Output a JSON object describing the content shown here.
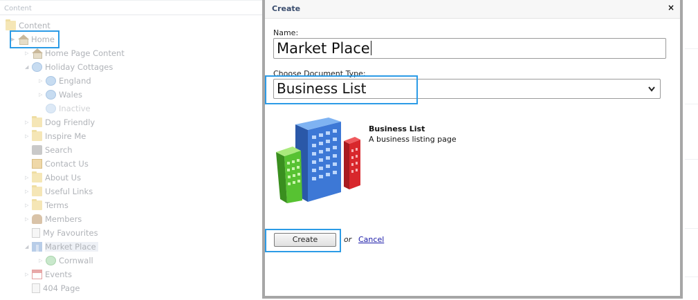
{
  "tree": {
    "header": "Content",
    "items": [
      {
        "label": "Content",
        "icon": "folder-icon"
      },
      {
        "label": "Home",
        "icon": "house-icon"
      },
      {
        "label": "Home Page Content",
        "icon": "house-icon"
      },
      {
        "label": "Holiday Cottages",
        "icon": "globe-icon"
      },
      {
        "label": "England",
        "icon": "globe-icon"
      },
      {
        "label": "Wales",
        "icon": "globe-icon"
      },
      {
        "label": "Inactive",
        "icon": "globe-icon"
      },
      {
        "label": "Dog Friendly",
        "icon": "folder-icon"
      },
      {
        "label": "Inspire Me",
        "icon": "folder-icon"
      },
      {
        "label": "Search",
        "icon": "search-icon"
      },
      {
        "label": "Contact Us",
        "icon": "contact-icon"
      },
      {
        "label": "About Us",
        "icon": "folder-icon"
      },
      {
        "label": "Useful Links",
        "icon": "folder-icon"
      },
      {
        "label": "Terms",
        "icon": "folder-icon"
      },
      {
        "label": "Members",
        "icon": "members-icon"
      },
      {
        "label": "My Favourites",
        "icon": "page-icon"
      },
      {
        "label": "Market Place",
        "icon": "market-icon"
      },
      {
        "label": "Cornwall",
        "icon": "globe-icon"
      },
      {
        "label": "Events",
        "icon": "calendar-icon"
      },
      {
        "label": "404 Page",
        "icon": "page-icon"
      }
    ]
  },
  "modal": {
    "title": "Create",
    "close_glyph": "×",
    "name_label": "Name:",
    "name_value": "Market Place",
    "doctype_label": "Choose Document Type:",
    "doctype_value": "Business List",
    "doctype_chevron": "⌄",
    "doc_title": "Business List",
    "doc_description": "A business listing page",
    "create_button": "Create",
    "or_text": "or",
    "cancel_link": "Cancel"
  },
  "colors": {
    "highlight": "#2b9be6",
    "modal_border": "#a6a6a6",
    "title_text": "#3a4d6e",
    "link": "#1a1aa8"
  }
}
